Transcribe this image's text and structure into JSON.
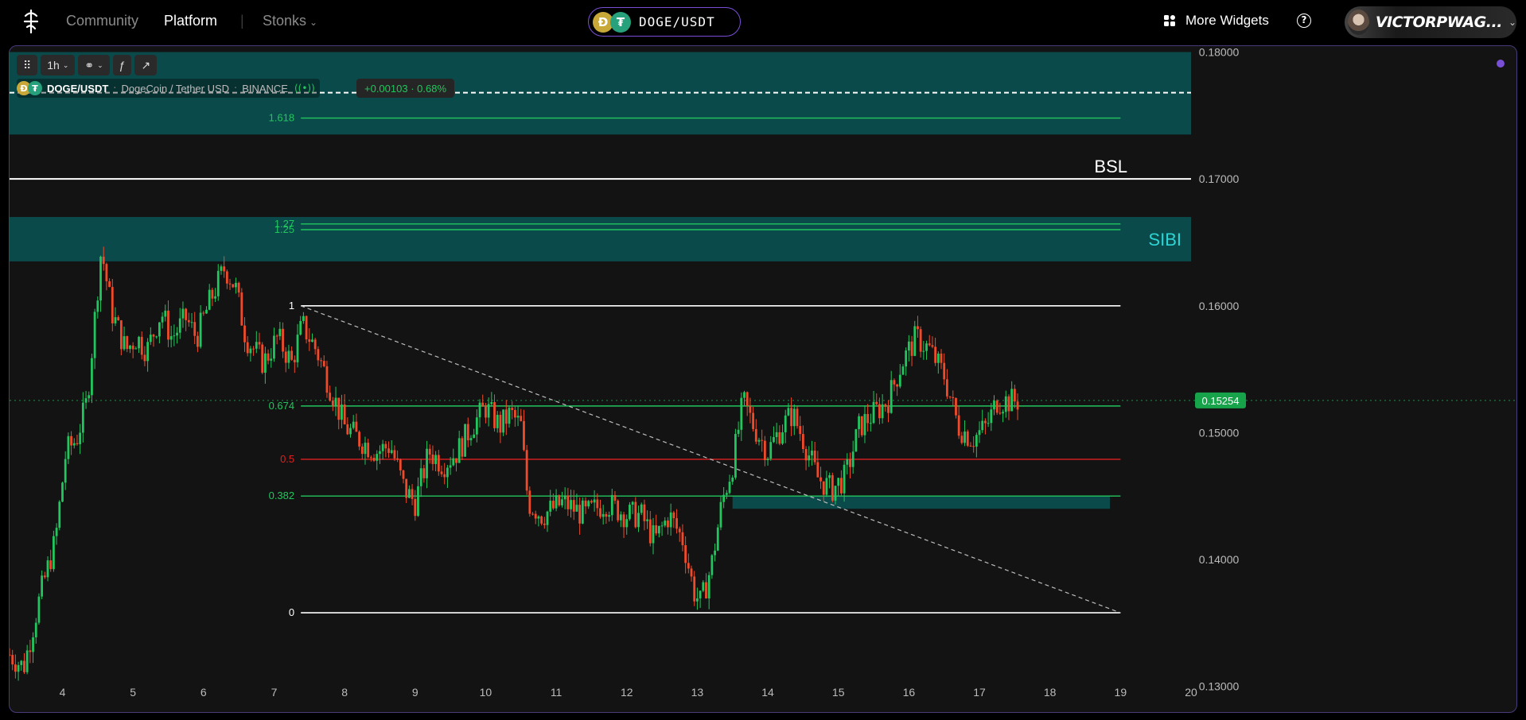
{
  "topbar": {
    "nav": {
      "community": "Community",
      "platform": "Platform",
      "stonks": "Stonks"
    },
    "pair": {
      "label": "DOGE/USDT",
      "base_glyph": "Ð",
      "quote_glyph": "₮"
    },
    "widgets_label": "More Widgets",
    "help_glyph": "?",
    "user_name": "VICTORPWAG..."
  },
  "toolbar": {
    "interval": "1h",
    "chart_type_glyph": "⚭",
    "indicators_glyph": "ƒ",
    "drawing_glyph": "↗"
  },
  "legend": {
    "pair": "DOGE/USDT",
    "description": "DogeCoin / Tether USD",
    "exchange": "BINANCE",
    "change": "+0.00103 · 0.68%"
  },
  "colors": {
    "up": "#22c55e",
    "down": "#ef4b2a",
    "zone": "#0b4a4a",
    "sibi_text": "#2dd4d4",
    "fib_green": "#22c55e",
    "fib_red": "#e02020",
    "accent": "#7a4fd8"
  },
  "chart_data": {
    "type": "candlestick",
    "xlim": [
      3.25,
      20.0
    ],
    "ylim": [
      0.12785,
      0.18047
    ],
    "y_ticks": [
      "0.18000",
      "0.17000",
      "0.16000",
      "0.15000",
      "0.14000",
      "0.13000"
    ],
    "y_tick_values": [
      0.18,
      0.17,
      0.16,
      0.15,
      0.14,
      0.13
    ],
    "x_ticks": [
      "4",
      "5",
      "6",
      "7",
      "8",
      "9",
      "10",
      "11",
      "12",
      "13",
      "14",
      "15",
      "16",
      "17",
      "18",
      "19",
      "20"
    ],
    "x_tick_values": [
      4,
      5,
      6,
      7,
      8,
      9,
      10,
      11,
      12,
      13,
      14,
      15,
      16,
      17,
      18,
      19,
      20
    ],
    "last_price": "0.15254",
    "last_price_value": 0.15254,
    "price_path": [
      [
        3.25,
        0.1325
      ],
      [
        3.45,
        0.1315
      ],
      [
        3.7,
        0.1375
      ],
      [
        3.9,
        0.1415
      ],
      [
        4.05,
        0.1485
      ],
      [
        4.2,
        0.1495
      ],
      [
        4.35,
        0.1525
      ],
      [
        4.55,
        0.1645
      ],
      [
        4.7,
        0.1595
      ],
      [
        4.9,
        0.1565
      ],
      [
        5.05,
        0.1575
      ],
      [
        5.2,
        0.1565
      ],
      [
        5.4,
        0.1595
      ],
      [
        5.55,
        0.1575
      ],
      [
        5.75,
        0.159
      ],
      [
        5.9,
        0.1575
      ],
      [
        6.1,
        0.1605
      ],
      [
        6.3,
        0.163
      ],
      [
        6.45,
        0.1615
      ],
      [
        6.6,
        0.1575
      ],
      [
        6.85,
        0.1555
      ],
      [
        7.05,
        0.1575
      ],
      [
        7.25,
        0.1555
      ],
      [
        7.4,
        0.1585
      ],
      [
        7.6,
        0.1565
      ],
      [
        7.8,
        0.1535
      ],
      [
        8.0,
        0.1505
      ],
      [
        8.2,
        0.1495
      ],
      [
        8.45,
        0.1485
      ],
      [
        8.65,
        0.149
      ],
      [
        8.85,
        0.1455
      ],
      [
        9.0,
        0.1445
      ],
      [
        9.2,
        0.1485
      ],
      [
        9.4,
        0.1475
      ],
      [
        9.6,
        0.1485
      ],
      [
        9.8,
        0.1505
      ],
      [
        10.0,
        0.152
      ],
      [
        10.2,
        0.1505
      ],
      [
        10.35,
        0.1515
      ],
      [
        10.5,
        0.1505
      ],
      [
        10.6,
        0.1445
      ],
      [
        10.8,
        0.1435
      ],
      [
        11.1,
        0.1445
      ],
      [
        11.4,
        0.1435
      ],
      [
        11.7,
        0.1445
      ],
      [
        12.0,
        0.1435
      ],
      [
        12.2,
        0.1435
      ],
      [
        12.4,
        0.1415
      ],
      [
        12.6,
        0.1435
      ],
      [
        12.8,
        0.1415
      ],
      [
        12.95,
        0.1375
      ],
      [
        13.05,
        0.1365
      ],
      [
        13.2,
        0.1395
      ],
      [
        13.35,
        0.1445
      ],
      [
        13.5,
        0.1475
      ],
      [
        13.65,
        0.1525
      ],
      [
        13.8,
        0.1505
      ],
      [
        14.0,
        0.1485
      ],
      [
        14.2,
        0.1505
      ],
      [
        14.35,
        0.1515
      ],
      [
        14.5,
        0.1495
      ],
      [
        14.7,
        0.1465
      ],
      [
        14.9,
        0.1455
      ],
      [
        15.1,
        0.1465
      ],
      [
        15.3,
        0.1505
      ],
      [
        15.5,
        0.1515
      ],
      [
        15.7,
        0.1525
      ],
      [
        15.9,
        0.1555
      ],
      [
        16.1,
        0.1575
      ],
      [
        16.3,
        0.1565
      ],
      [
        16.5,
        0.1545
      ],
      [
        16.7,
        0.1505
      ],
      [
        16.9,
        0.1495
      ],
      [
        17.1,
        0.1505
      ],
      [
        17.25,
        0.1525
      ],
      [
        17.4,
        0.1525
      ],
      [
        17.55,
        0.1525
      ]
    ],
    "levels": [
      {
        "label": "BSL",
        "value": 0.17
      },
      {
        "label": "SIBI",
        "low": 0.1635,
        "high": 0.167
      },
      {
        "label": "",
        "low": 0.1735,
        "high": 0.18
      },
      {
        "label": "",
        "low": 0.144,
        "high": 0.145
      }
    ],
    "dashed_level": 0.1768,
    "fib_levels": [
      {
        "label": "1.618",
        "value": 0.1748,
        "color": "green"
      },
      {
        "label": "1.27",
        "value": 0.16645,
        "color": "green"
      },
      {
        "label": "1.25",
        "value": 0.166,
        "color": "green"
      },
      {
        "label": "1",
        "value": 0.16,
        "color": "white"
      },
      {
        "label": "0.674",
        "value": 0.1521,
        "color": "green"
      },
      {
        "label": "0.5",
        "value": 0.1479,
        "color": "red"
      },
      {
        "label": "0.382",
        "value": 0.145,
        "color": "green"
      },
      {
        "label": "0",
        "value": 0.1358,
        "color": "white"
      }
    ],
    "fib_x_range": [
      7.38,
      19.0
    ],
    "trendline": [
      [
        7.38,
        0.16
      ],
      [
        19.0,
        0.1358
      ]
    ]
  }
}
